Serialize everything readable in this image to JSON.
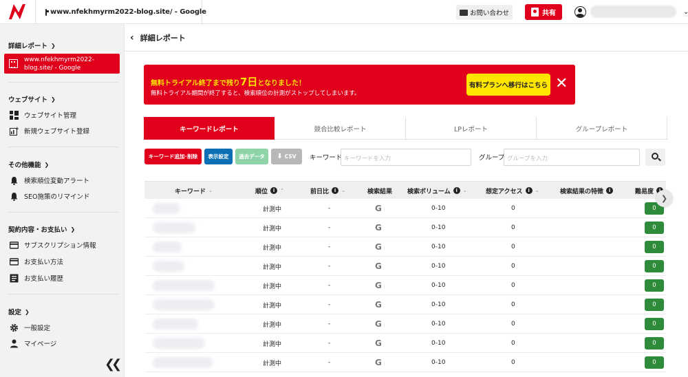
{
  "topbar": {
    "site_title": "www.nfekhmyrm2022-blog.site/ - Google",
    "contact_label": "お問い合わせ",
    "share_label": "共有"
  },
  "sidebar": {
    "sections": [
      {
        "title": "詳細レポート"
      },
      {
        "title": "ウェブサイト"
      },
      {
        "title": "その他機能"
      },
      {
        "title": "契約内容・お支払い"
      },
      {
        "title": "設定"
      }
    ],
    "active_site": "www.nfekhmyrm2022-blog.site/ - Google",
    "items": {
      "website_manage": "ウェブサイト管理",
      "website_new": "新規ウェブサイト登録",
      "rank_alert": "検索順位変動アラート",
      "seo_reminder": "SEO施策のリマインド",
      "subscription": "サブスクリプション情報",
      "payment_method": "お支払い方法",
      "payment_history": "お支払い履歴",
      "general": "一般設定",
      "mypage": "マイページ"
    }
  },
  "main": {
    "title": "詳細レポート",
    "banner": {
      "line1_prefix": "無料トライアル終了まで残り",
      "line1_days": "7日",
      "line1_suffix": "となりました！",
      "line2": "無料トライアル期間が終了すると、検索順位の計測がストップしてしまいます。",
      "cta": "有料プランへ移行はこちら"
    },
    "tabs": [
      "キーワードレポート",
      "競合比較レポート",
      "LPレポート",
      "グループレポート"
    ],
    "toolbar": {
      "add_remove": "キーワード追加･削除",
      "display_settings": "表示設定",
      "past_data": "過去データ",
      "csv": "CSV",
      "keyword_label": "キーワード",
      "keyword_placeholder": "キーワードを入力",
      "group_label": "グループ",
      "group_placeholder": "グループを入力"
    },
    "table": {
      "headers": [
        "キーワード",
        "順位",
        "前日比",
        "検索結果",
        "検索ボリューム",
        "想定アクセス",
        "検索結果の特徴",
        "難易度"
      ],
      "rows": [
        {
          "rank": "計測中",
          "diff": "-",
          "result": "G",
          "volume": "0-10",
          "access": "0",
          "difficulty": "0"
        },
        {
          "rank": "計測中",
          "diff": "-",
          "result": "G",
          "volume": "0-10",
          "access": "0",
          "difficulty": "0"
        },
        {
          "rank": "計測中",
          "diff": "-",
          "result": "G",
          "volume": "0-10",
          "access": "0",
          "difficulty": "0"
        },
        {
          "rank": "計測中",
          "diff": "-",
          "result": "G",
          "volume": "0-10",
          "access": "0",
          "difficulty": "0"
        },
        {
          "rank": "計測中",
          "diff": "-",
          "result": "G",
          "volume": "0-10",
          "access": "0",
          "difficulty": "0"
        },
        {
          "rank": "計測中",
          "diff": "-",
          "result": "G",
          "volume": "0-10",
          "access": "0",
          "difficulty": "0"
        },
        {
          "rank": "計測中",
          "diff": "-",
          "result": "G",
          "volume": "0-10",
          "access": "0",
          "difficulty": "0"
        },
        {
          "rank": "計測中",
          "diff": "-",
          "result": "G",
          "volume": "0-10",
          "access": "0",
          "difficulty": "0"
        },
        {
          "rank": "計測中",
          "diff": "-",
          "result": "G",
          "volume": "0-10",
          "access": "0",
          "difficulty": "0"
        }
      ]
    }
  },
  "colors": {
    "brand_red": "#e0001b",
    "cta_yellow": "#ffe600",
    "blue_button": "#0a6fb5",
    "green_button": "#8fd4a8",
    "grey_button": "#b8b8b8",
    "difficulty_green": "#2e8b3a"
  }
}
